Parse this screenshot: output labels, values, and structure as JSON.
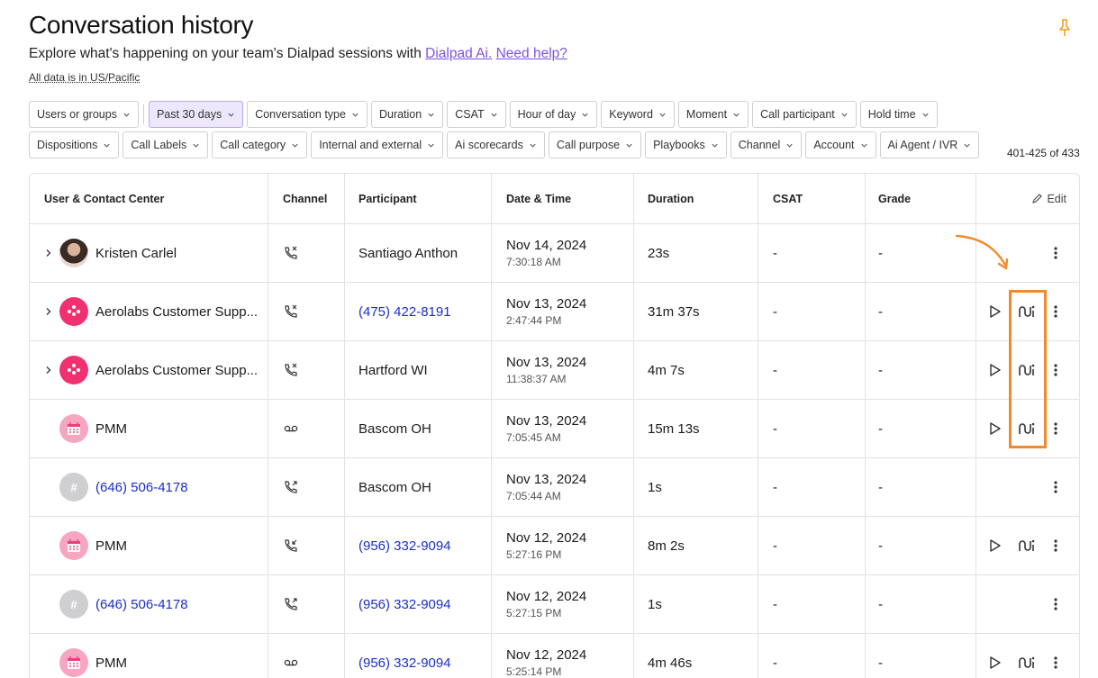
{
  "page": {
    "title": "Conversation history",
    "subtitle_prefix": "Explore what's happening on your team's Dialpad sessions with",
    "link_ai": "Dialpad Ai.",
    "link_help": "Need help?",
    "timezone_note": "All data is in US/Pacific",
    "result_count": "401-425 of 433"
  },
  "filters_row1": [
    "Users or groups",
    "Past 30 days",
    "Conversation type",
    "Duration",
    "CSAT",
    "Hour of day",
    "Keyword",
    "Moment",
    "Call participant",
    "Hold time"
  ],
  "filters_row2": [
    "Dispositions",
    "Call Labels",
    "Call category",
    "Internal and external",
    "Ai scorecards",
    "Call purpose",
    "Playbooks",
    "Channel",
    "Account",
    "Ai Agent / IVR"
  ],
  "columns": {
    "user": "User & Contact Center",
    "channel": "Channel",
    "participant": "Participant",
    "datetime": "Date & Time",
    "duration": "Duration",
    "csat": "CSAT",
    "grade": "Grade",
    "edit": "Edit"
  },
  "rows": [
    {
      "user": "Kristen Carlel",
      "participant": "Santiago Anthon",
      "date": "Nov 14, 2024",
      "time": "7:30:18 AM",
      "duration": "23s",
      "csat": "-",
      "grade": "-"
    },
    {
      "user": "Aerolabs Customer Supp...",
      "participant": "(475) 422-8191",
      "date": "Nov 13, 2024",
      "time": "2:47:44 PM",
      "duration": "31m 37s",
      "csat": "-",
      "grade": "-"
    },
    {
      "user": "Aerolabs Customer Supp...",
      "participant": "Hartford WI",
      "date": "Nov 13, 2024",
      "time": "11:38:37 AM",
      "duration": "4m 7s",
      "csat": "-",
      "grade": "-"
    },
    {
      "user": "PMM",
      "participant": "Bascom OH",
      "date": "Nov 13, 2024",
      "time": "7:05:45 AM",
      "duration": "15m 13s",
      "csat": "-",
      "grade": "-"
    },
    {
      "user": "(646) 506-4178",
      "avatar_text": "#",
      "participant": "Bascom OH",
      "date": "Nov 13, 2024",
      "time": "7:05:44 AM",
      "duration": "1s",
      "csat": "-",
      "grade": "-"
    },
    {
      "user": "PMM",
      "participant": "(956) 332-9094",
      "date": "Nov 12, 2024",
      "time": "5:27:16 PM",
      "duration": "8m 2s",
      "csat": "-",
      "grade": "-"
    },
    {
      "user": "(646) 506-4178",
      "avatar_text": "#",
      "participant": "(956) 332-9094",
      "date": "Nov 12, 2024",
      "time": "5:27:15 PM",
      "duration": "1s",
      "csat": "-",
      "grade": "-"
    },
    {
      "user": "PMM",
      "participant": "(956) 332-9094",
      "date": "Nov 12, 2024",
      "time": "5:25:14 PM",
      "duration": "4m 46s",
      "csat": "-",
      "grade": "-"
    }
  ],
  "colors": {
    "accent": "#7c52e8",
    "link": "#1b2fc7",
    "highlight": "#f08a2c",
    "pin": "#f0a020"
  }
}
